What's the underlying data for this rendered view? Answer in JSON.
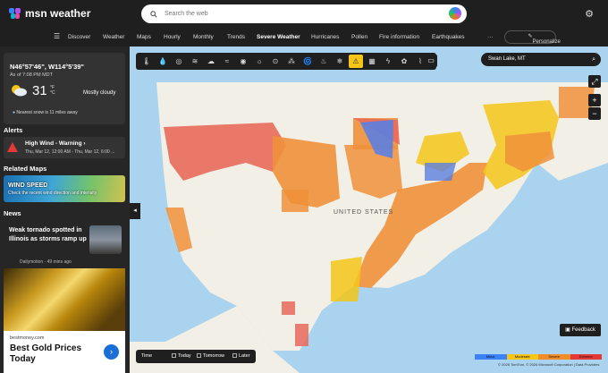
{
  "app": {
    "brand": "msn weather"
  },
  "search": {
    "placeholder": "Search the web"
  },
  "nav": {
    "items": [
      "Discover",
      "Weather",
      "Maps",
      "Hourly",
      "Monthly",
      "Trends",
      "Severe Weather",
      "Hurricanes",
      "Pollen",
      "Fire information",
      "Earthquakes"
    ],
    "more": "···",
    "personalize": "Personalize"
  },
  "location": {
    "coords": "N46°57'46\", W114°5'39\"",
    "as_of": "As of 7:08 PM MDT",
    "temp": "31",
    "unit_f": "°F",
    "unit_c": "°C",
    "condition": "Mostly cloudy",
    "snow": "Nearest snow is 11 miles away"
  },
  "alerts": {
    "heading": "Alerts",
    "title": "High Wind - Warning",
    "time": "Thu, Mar 12, 12:00 AM - Thu, Mar 12, 6:00 ..."
  },
  "related_maps": {
    "heading": "Related Maps",
    "title": "WIND SPEED",
    "subtitle": "Check the recent wind direction and intensity"
  },
  "news": {
    "heading": "News",
    "title": "Weak tornado spotted in Illinois as storms ramp up",
    "source": "Dailymotion · 49 mins ago"
  },
  "ad": {
    "domain": "bestmoney.com",
    "headline": "Best Gold Prices Today",
    "cta_icon": "arrow-right-icon"
  },
  "map": {
    "search_value": "Swan Lake, MT",
    "country_label": "UNITED STATES",
    "feedback": "Feedback",
    "time_label": "Time",
    "time_options": [
      "Today",
      "Tomorrow",
      "Later"
    ],
    "legend": [
      {
        "label": "Minor",
        "color": "#3b82f6"
      },
      {
        "label": "Moderate",
        "color": "#f5c518"
      },
      {
        "label": "Severe",
        "color": "#f28c28"
      },
      {
        "label": "Extreme",
        "color": "#e53935"
      }
    ],
    "copyright": "© 2026 TomTom, © 2026 Microsoft Corporation | Data Providers"
  }
}
